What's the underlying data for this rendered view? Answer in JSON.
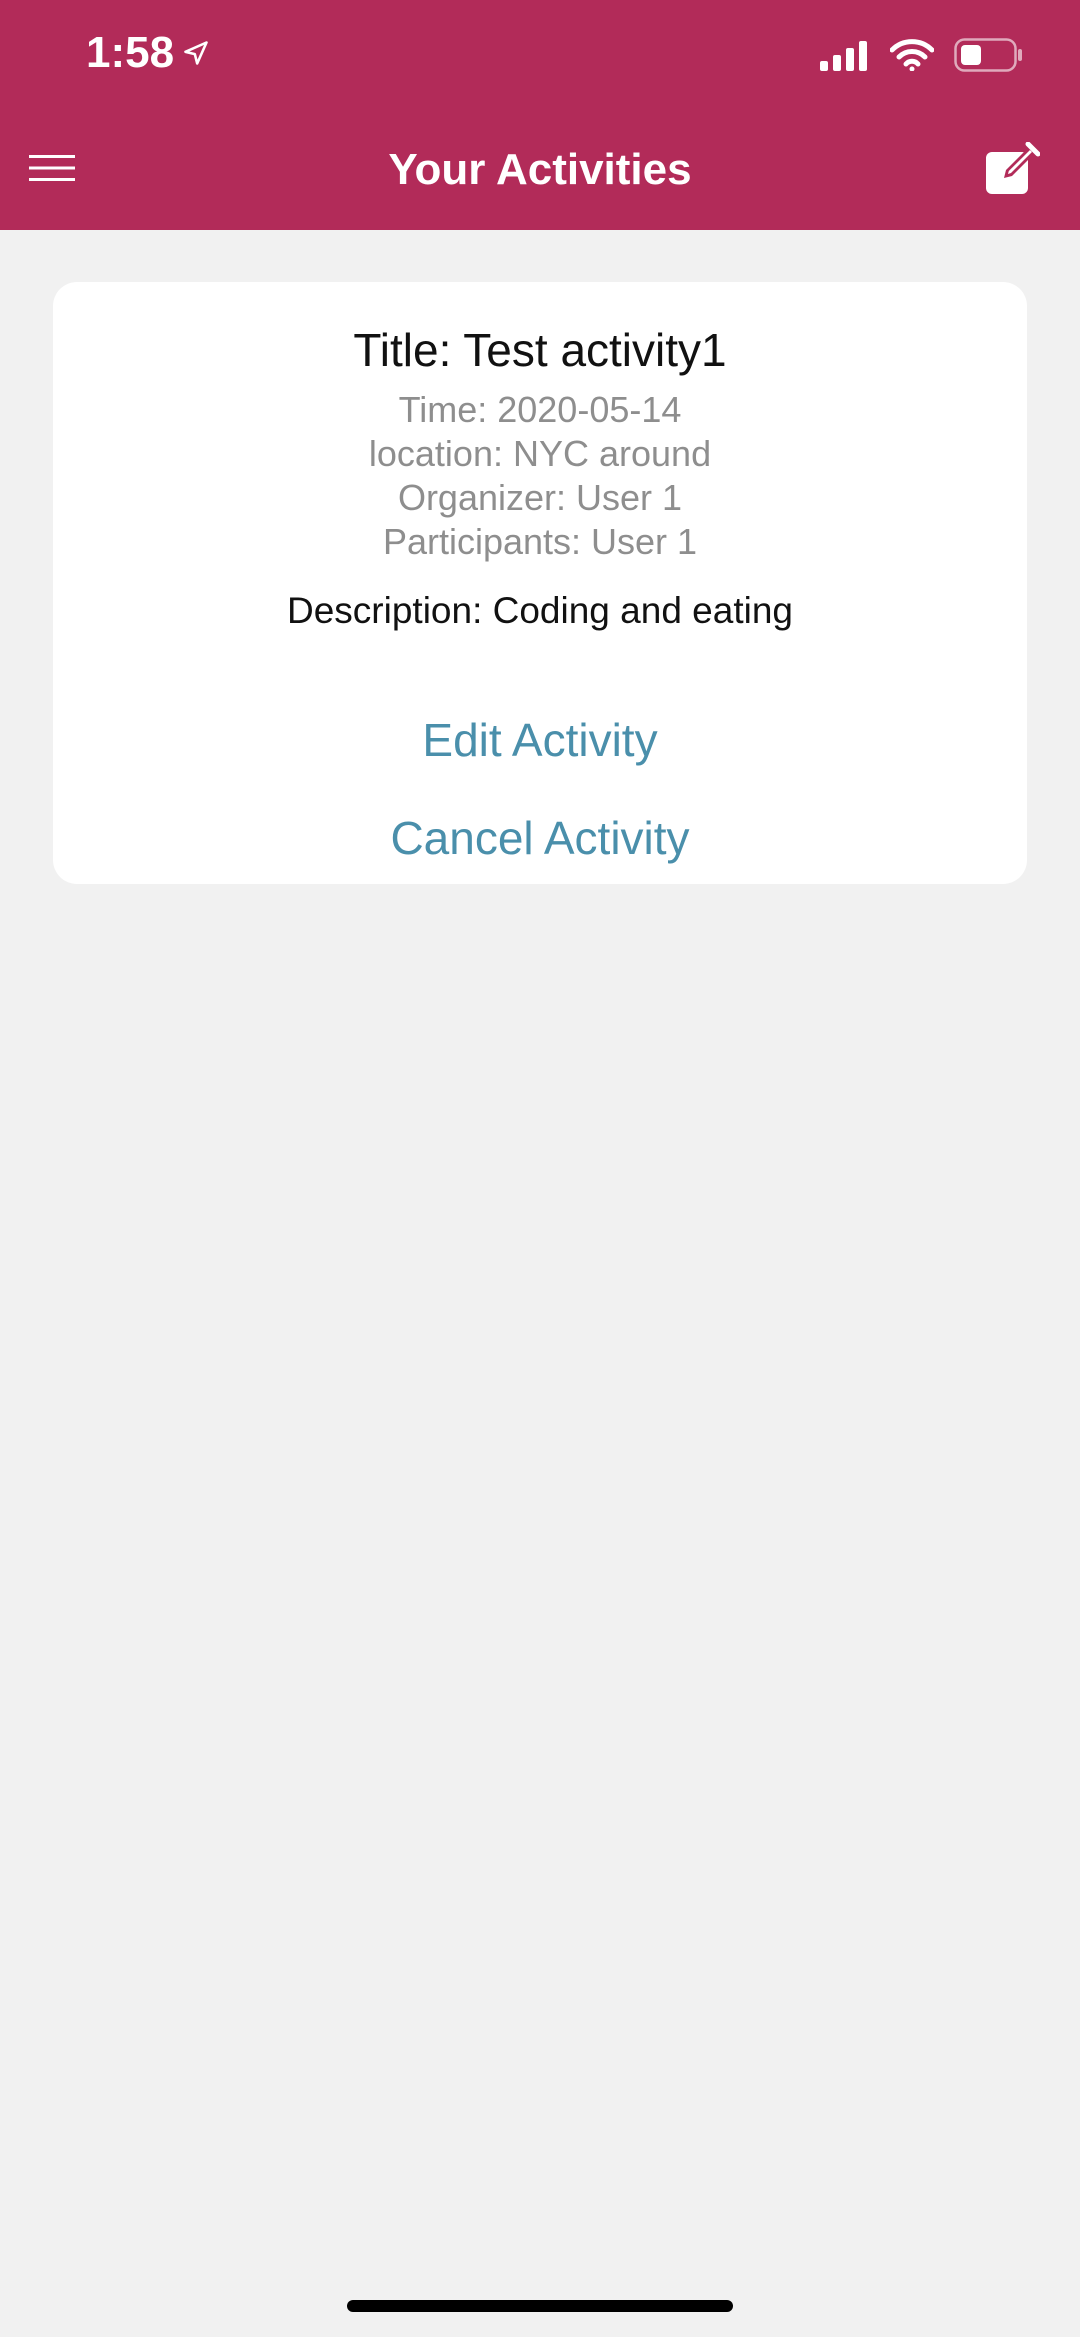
{
  "status_bar": {
    "time": "1:58",
    "icons": [
      "location-arrow-icon",
      "signal-icon",
      "wifi-icon",
      "battery-icon"
    ]
  },
  "nav": {
    "title": "Your Activities",
    "menu_icon": "hamburger-menu-icon",
    "compose_icon": "compose-edit-icon"
  },
  "activity": {
    "title": "Title: Test activity1",
    "time": "Time: 2020-05-14",
    "location": "location: NYC around",
    "organizer": "Organizer: User 1",
    "participants": "Participants: User 1",
    "description": "Description: Coding and eating",
    "edit_label": "Edit Activity",
    "cancel_label": "Cancel Activity"
  },
  "colors": {
    "header_bg": "#b22b59",
    "page_bg": "#f1f1f1",
    "link": "#4a8fab"
  }
}
